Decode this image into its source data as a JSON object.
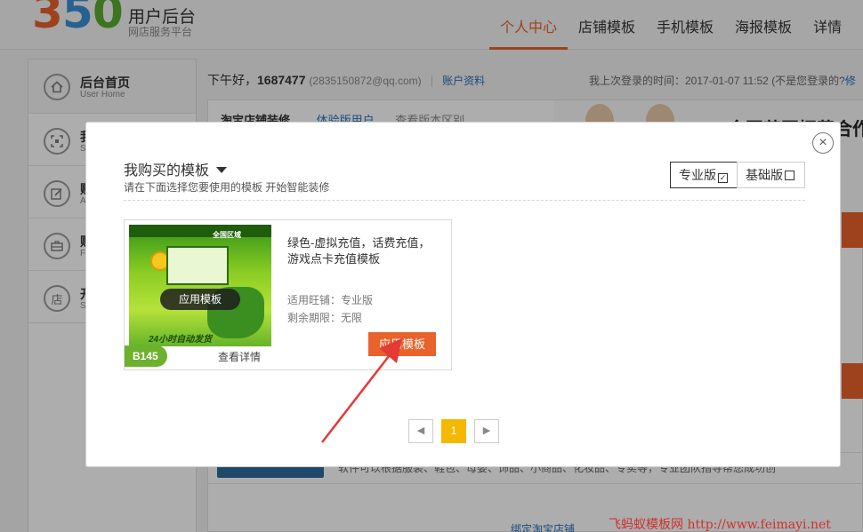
{
  "header": {
    "logo_text": "350",
    "title": "用户后台",
    "subtitle": "网店服务平台",
    "nav": [
      "个人中心",
      "店铺模板",
      "手机模板",
      "海报模板",
      "详情"
    ],
    "active_index": 0
  },
  "sidebar": {
    "items": [
      {
        "title": "后台首页",
        "sub": "User Home",
        "icon": "home-icon"
      },
      {
        "title": "我",
        "sub": "S",
        "icon": "scan-icon"
      },
      {
        "title": "账",
        "sub": "A",
        "icon": "edit-icon"
      },
      {
        "title": "财",
        "sub": "F",
        "icon": "briefcase-icon"
      },
      {
        "title": "开",
        "sub": "S",
        "icon": "store-icon",
        "glyph": "店"
      }
    ]
  },
  "main": {
    "greeting_prefix": "下午好，",
    "username": "1687477",
    "email": "(2835150872@qq.com)",
    "account_link": "账户资料",
    "last_login": "我上次登录的时间：2017-01-07 11:52 (不是您登录的?",
    "last_login_link": "修",
    "panel": {
      "title": "淘宝店铺装修",
      "link": "体验版用户",
      "compare": "查看版本区别",
      "promo_title": "全国范围招募合作伙",
      "strip_text": "软件可以根据服装、鞋包、母婴、饰品、小商品、化妆品、专卖等，专业团队指导帮您成功创",
      "bind_link": "绑定淘宝店铺"
    }
  },
  "modal": {
    "title": "我购买的模板",
    "subtitle": "请在下面选择您要使用的模板 开始智能装修",
    "tabs": [
      {
        "label": "专业版",
        "checked": true
      },
      {
        "label": "基础版",
        "checked": false
      }
    ],
    "close_label": "×",
    "card": {
      "name": "绿色-虚拟充值，话费充值，游戏点卡充值模板",
      "applicable": "适用旺铺：专业版",
      "remaining": "剩余期限：无限",
      "apply_button": "应用模板",
      "overlay_button": "应用模板",
      "code": "B145",
      "detail_link": "查看详情",
      "thumb_slogan": "全国区域",
      "thumb_tagline": "24小时自动发货"
    },
    "pagination": {
      "prev": "◀",
      "current": "1",
      "next": "▶"
    }
  },
  "colors": {
    "accent": "#e8622c",
    "link": "#2a6ebb",
    "page_current": "#f5b800",
    "code_tag": "#6db12f",
    "arrow": "#e53935"
  },
  "watermark": "飞蚂蚁模板网 http://www.feimayi.net"
}
